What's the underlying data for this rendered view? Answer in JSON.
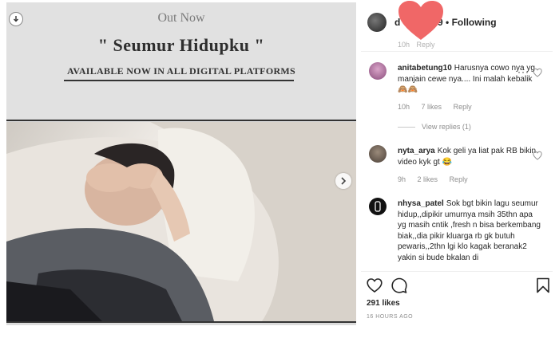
{
  "poster": {
    "out_now": "Out Now",
    "title": "\" Seumur Hidupku \"",
    "available": "AVAILABLE NOW  IN ALL DIGITAL PLATFORMS"
  },
  "header": {
    "username_visible_start": "d",
    "username_visible_end": "99",
    "separator": "•",
    "follow_label": "Following"
  },
  "cut_comment": {
    "time": "10h",
    "reply_label": "Reply"
  },
  "comments": [
    {
      "user": "anitabetung10",
      "text": "Harusnya cowo nya yg manjain cewe nya.... Ini malah kebalik 🙈🙈",
      "time": "10h",
      "likes": "7 likes",
      "reply_label": "Reply",
      "view_replies": "View replies (1)"
    },
    {
      "user": "nyta_arya",
      "text": "Kok geli ya liat pak RB bikin video kyk gt 😂",
      "time": "9h",
      "likes": "2 likes",
      "reply_label": "Reply"
    },
    {
      "user": "nhysa_patel",
      "text": "Sok bgt bikin lagu seumur hidup,,dipikir umurnya msih 35thn apa yg masih cntik ,fresh n bisa berkembang biak,,dia pikir kluarga rb gk butuh pewaris,,2thn lgi klo kagak beranak2 yakin si bude bkalan di"
    }
  ],
  "more_options": "···",
  "post_footer": {
    "likes": "291 likes",
    "time_ago": "16 HOURS AGO"
  },
  "icons": {
    "download": "download-icon",
    "next": "chevron-right-icon",
    "like": "heart-outline-icon",
    "comment": "speech-bubble-icon",
    "save": "bookmark-icon"
  },
  "colors": {
    "overlay_heart": "#f06767",
    "muted_text": "#8e8e8e",
    "primary_text": "#262626"
  }
}
